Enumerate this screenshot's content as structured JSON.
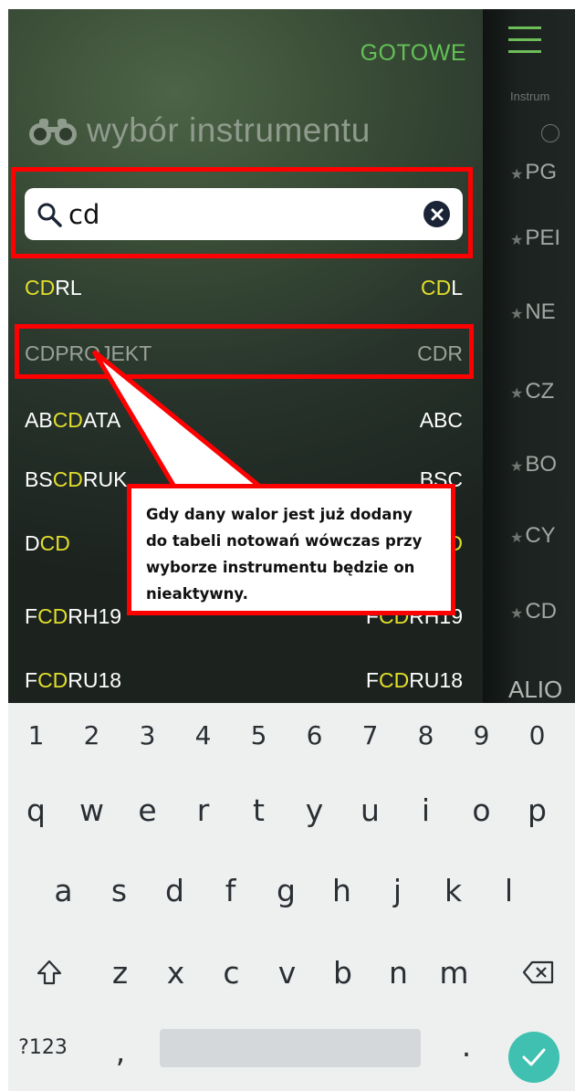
{
  "panel": {
    "done_label": "GOTOWE",
    "title": "wybór instrumentu",
    "binoculars_icon": "binoculars-icon",
    "search": {
      "value": "cd",
      "search_icon": "magnifier-icon",
      "clear_icon": "clear-x-icon"
    },
    "results": [
      {
        "name_pre": "",
        "name_hl": "CD",
        "name_post": "RL",
        "ticker_pre": "",
        "ticker_hl": "CD",
        "ticker_post": "L",
        "disabled": false
      },
      {
        "name_pre": "CDPROJEKT",
        "name_hl": "",
        "name_post": "",
        "ticker_pre": "CDR",
        "ticker_hl": "",
        "ticker_post": "",
        "disabled": true
      },
      {
        "name_pre": "AB",
        "name_hl": "CD",
        "name_post": "ATA",
        "ticker_pre": "ABC",
        "ticker_hl": "",
        "ticker_post": "",
        "disabled": false
      },
      {
        "name_pre": "BS",
        "name_hl": "CD",
        "name_post": "RUK",
        "ticker_pre": "BSC",
        "ticker_hl": "",
        "ticker_post": "",
        "disabled": false
      },
      {
        "name_pre": "D",
        "name_hl": "CD",
        "name_post": "",
        "ticker_pre": "D",
        "ticker_hl": "CD",
        "ticker_post": "",
        "disabled": false
      },
      {
        "name_pre": "F",
        "name_hl": "CD",
        "name_post": "RH19",
        "ticker_pre": "F",
        "ticker_hl": "CD",
        "ticker_post": "RH19",
        "disabled": false
      },
      {
        "name_pre": "F",
        "name_hl": "CD",
        "name_post": "RU18",
        "ticker_pre": "F",
        "ticker_hl": "CD",
        "ticker_post": "RU18",
        "disabled": false
      }
    ]
  },
  "right_pane": {
    "menu_icon": "hamburger-menu-icon",
    "column_label": "Instrum",
    "items": [
      {
        "label": "PG"
      },
      {
        "label": "PEI"
      },
      {
        "label": "NE"
      },
      {
        "label": "CZ"
      },
      {
        "label": "BO"
      },
      {
        "label": "CY"
      },
      {
        "label": "CD"
      }
    ],
    "footer_item": "ALIO"
  },
  "annotation": {
    "callout_text": "Gdy dany walor jest już dodany do tabeli notowań wówczas przy wyborze instrumentu będzie on nieaktywny."
  },
  "keyboard": {
    "number_row": [
      "1",
      "2",
      "3",
      "4",
      "5",
      "6",
      "7",
      "8",
      "9",
      "0"
    ],
    "row1": [
      "q",
      "w",
      "e",
      "r",
      "t",
      "y",
      "u",
      "i",
      "o",
      "p"
    ],
    "row2": [
      "a",
      "s",
      "d",
      "f",
      "g",
      "h",
      "j",
      "k",
      "l"
    ],
    "row3": [
      "z",
      "x",
      "c",
      "v",
      "b",
      "n",
      "m"
    ],
    "shift_icon": "shift-arrow-icon",
    "backspace_icon": "backspace-icon",
    "symbols_label": "?123",
    "comma_label": ",",
    "period_label": ".",
    "enter_icon": "checkmark-icon"
  },
  "colors": {
    "accent_green": "#63c155",
    "highlight_yellow": "#e2de2c",
    "annotation_red": "#ff0000",
    "enter_teal": "#3fc0b0"
  }
}
